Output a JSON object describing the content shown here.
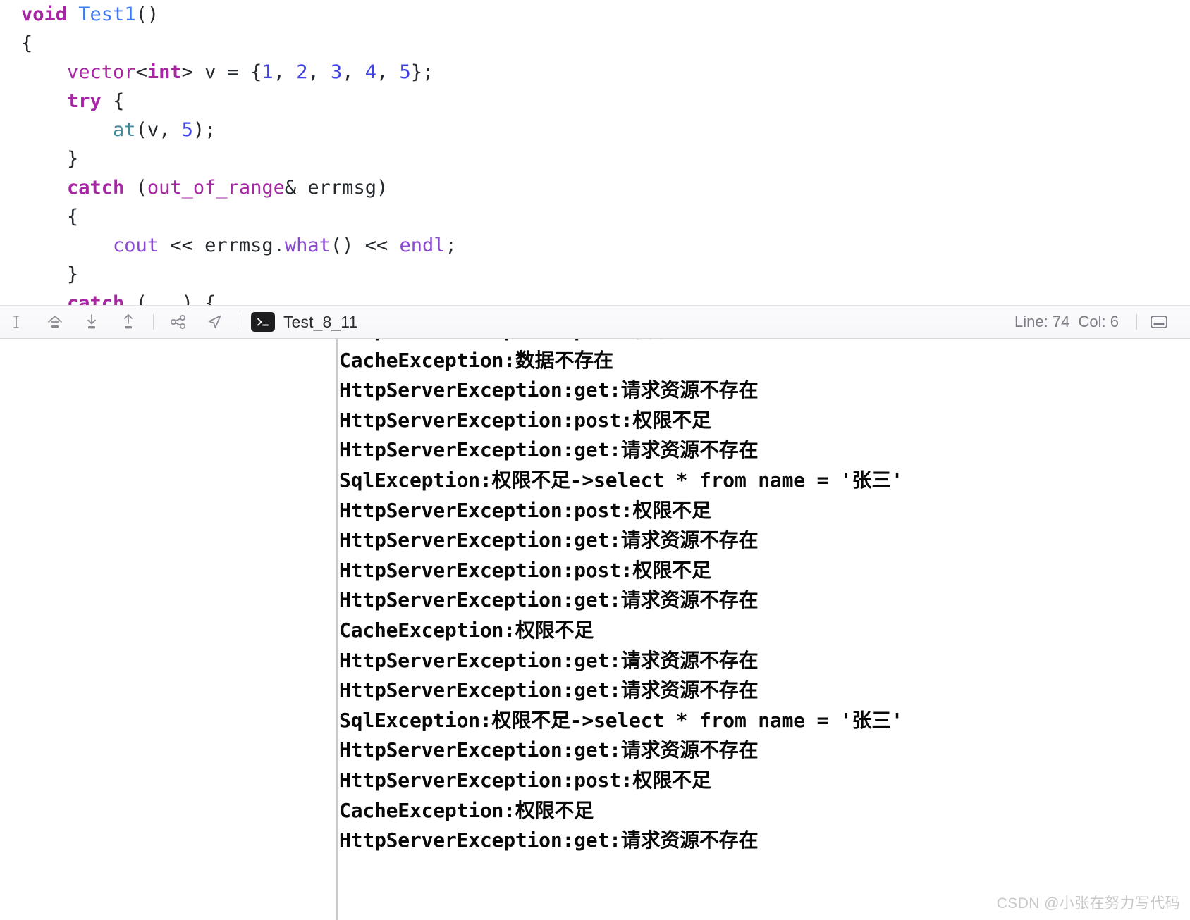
{
  "editor": {
    "language": "cpp",
    "code_lines": [
      [
        {
          "t": "void",
          "c": "kw"
        },
        {
          "t": " ",
          "c": "plain"
        },
        {
          "t": "Test1",
          "c": "type"
        },
        {
          "t": "()",
          "c": "punct"
        }
      ],
      [
        {
          "t": "{",
          "c": "punct"
        }
      ],
      [
        {
          "t": "    ",
          "c": "plain"
        },
        {
          "t": "vector",
          "c": "kw-plain"
        },
        {
          "t": "<",
          "c": "punct"
        },
        {
          "t": "int",
          "c": "kw"
        },
        {
          "t": "> v = {",
          "c": "punct"
        },
        {
          "t": "1",
          "c": "num"
        },
        {
          "t": ", ",
          "c": "punct"
        },
        {
          "t": "2",
          "c": "num"
        },
        {
          "t": ", ",
          "c": "punct"
        },
        {
          "t": "3",
          "c": "num"
        },
        {
          "t": ", ",
          "c": "punct"
        },
        {
          "t": "4",
          "c": "num"
        },
        {
          "t": ", ",
          "c": "punct"
        },
        {
          "t": "5",
          "c": "num"
        },
        {
          "t": "};",
          "c": "punct"
        }
      ],
      [
        {
          "t": "    ",
          "c": "plain"
        },
        {
          "t": "try",
          "c": "kw"
        },
        {
          "t": " {",
          "c": "punct"
        }
      ],
      [
        {
          "t": "        ",
          "c": "plain"
        },
        {
          "t": "at",
          "c": "fn"
        },
        {
          "t": "(v, ",
          "c": "punct"
        },
        {
          "t": "5",
          "c": "num"
        },
        {
          "t": ");",
          "c": "punct"
        }
      ],
      [
        {
          "t": "    ",
          "c": "plain"
        },
        {
          "t": "}",
          "c": "punct"
        }
      ],
      [
        {
          "t": "    ",
          "c": "plain"
        },
        {
          "t": "catch",
          "c": "kw"
        },
        {
          "t": " (",
          "c": "punct"
        },
        {
          "t": "out_of_range",
          "c": "kw-plain"
        },
        {
          "t": "& errmsg)",
          "c": "punct"
        }
      ],
      [
        {
          "t": "    ",
          "c": "plain"
        },
        {
          "t": "{",
          "c": "punct"
        }
      ],
      [
        {
          "t": "        ",
          "c": "plain"
        },
        {
          "t": "cout",
          "c": "member"
        },
        {
          "t": " << errmsg.",
          "c": "punct"
        },
        {
          "t": "what",
          "c": "member"
        },
        {
          "t": "() << ",
          "c": "punct"
        },
        {
          "t": "endl",
          "c": "member"
        },
        {
          "t": ";",
          "c": "punct"
        }
      ],
      [
        {
          "t": "    ",
          "c": "plain"
        },
        {
          "t": "}",
          "c": "punct"
        }
      ],
      [
        {
          "t": "    ",
          "c": "plain"
        },
        {
          "t": "catch",
          "c": "kw"
        },
        {
          "t": " (...) {",
          "c": "punct"
        }
      ]
    ]
  },
  "status_bar": {
    "toolbar_icons": [
      {
        "name": "cursor-icon",
        "label": "Cursor"
      },
      {
        "name": "home-upload-icon",
        "label": "Home"
      },
      {
        "name": "download-icon",
        "label": "Download"
      },
      {
        "name": "upload-icon",
        "label": "Upload"
      },
      {
        "name": "share-icon",
        "label": "Share"
      },
      {
        "name": "send-icon",
        "label": "Send"
      }
    ],
    "terminal_icon": "terminal-icon",
    "terminal_label": "Test_8_11",
    "caret_position": "Line: 74  Col: 6",
    "panel_toggle_icon": "panel-toggle-icon"
  },
  "console": {
    "lines": [
      "HttpServerException:post:权限不足",
      "CacheException:数据不存在",
      "HttpServerException:get:请求资源不存在",
      "HttpServerException:post:权限不足",
      "HttpServerException:get:请求资源不存在",
      "SqlException:权限不足->select * from name = '张三'",
      "HttpServerException:post:权限不足",
      "HttpServerException:get:请求资源不存在",
      "HttpServerException:post:权限不足",
      "HttpServerException:get:请求资源不存在",
      "CacheException:权限不足",
      "HttpServerException:get:请求资源不存在",
      "HttpServerException:get:请求资源不存在",
      "SqlException:权限不足->select * from name = '张三'",
      "HttpServerException:get:请求资源不存在",
      "HttpServerException:post:权限不足",
      "CacheException:权限不足",
      "HttpServerException:get:请求资源不存在"
    ]
  },
  "watermark": {
    "text": "CSDN @小张在努力写代码"
  }
}
